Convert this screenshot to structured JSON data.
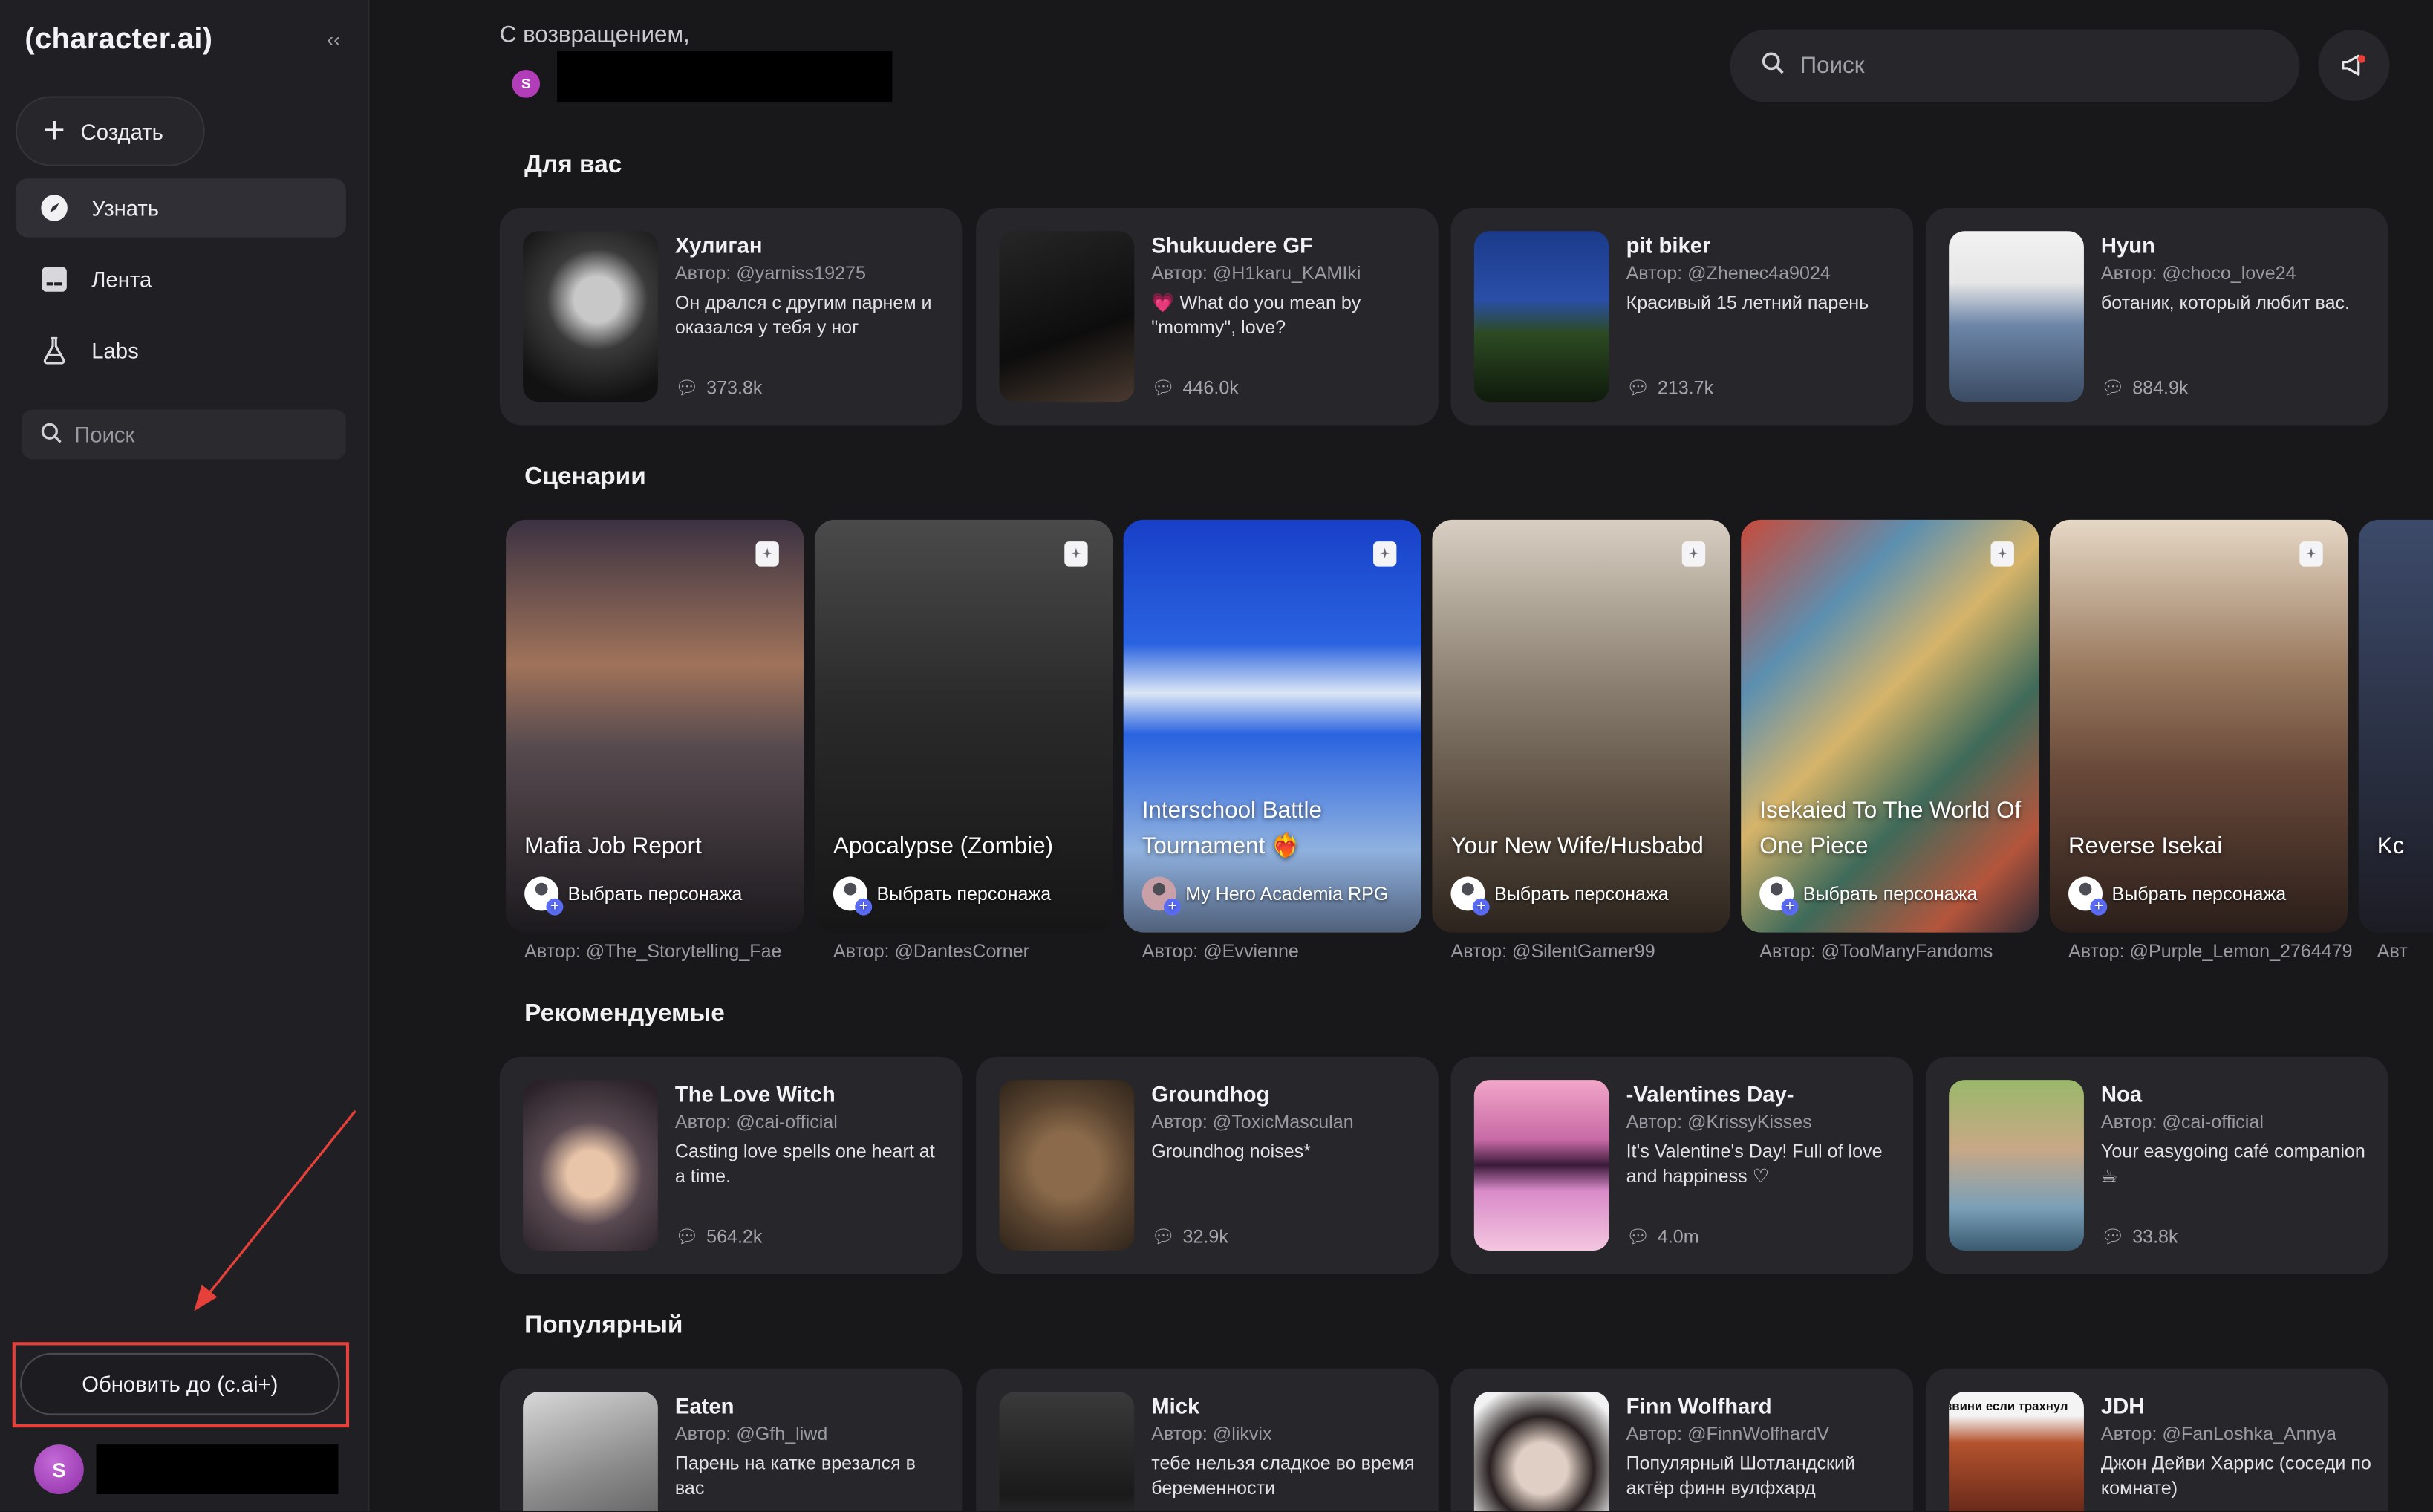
{
  "sidebar": {
    "logo": "(character.ai)",
    "collapse_icon": "‹‹",
    "create_label": "Создать",
    "nav": [
      {
        "label": "Узнать",
        "icon": "compass-icon",
        "active": true
      },
      {
        "label": "Лента",
        "icon": "feed-icon",
        "active": false
      },
      {
        "label": "Labs",
        "icon": "flask-icon",
        "active": false
      }
    ],
    "search_placeholder": "Поиск",
    "upgrade_label": "Обновить до (c.ai+)",
    "user_initial": "S"
  },
  "header": {
    "welcome": "С возвращением,",
    "user_initial": "S",
    "search_placeholder": "Поиск"
  },
  "sections": {
    "for_you": "Для вас",
    "scenarios": "Сценарии",
    "recommended": "Рекомендуемые",
    "popular": "Популярный"
  },
  "for_you": [
    {
      "name": "Хулиган",
      "author": "Автор: @yarniss19275",
      "desc": "Он дрался с другим парнем и оказался у тебя у ног",
      "count": "373.8k"
    },
    {
      "name": "Shukuudere GF",
      "author": "Автор: @H1karu_KAMIki",
      "desc": "💗 What do you mean by \"mommy\", love?",
      "count": "446.0k"
    },
    {
      "name": "pit biker",
      "author": "Автор: @Zhenec4a9024",
      "desc": "Красивый 15 летний парень",
      "count": "213.7k"
    },
    {
      "name": "Hyun",
      "author": "Автор: @choco_love24",
      "desc": "ботаник, который любит вас.",
      "count": "884.9k"
    }
  ],
  "scenarios": [
    {
      "title": "Mafia Job Report",
      "pick": "Выбрать персонажа",
      "author": "Автор: @The_Storytelling_Fae"
    },
    {
      "title": "Apocalypse (Zombie)",
      "pick": "Выбрать персонажа",
      "author": "Автор: @DantesCorner"
    },
    {
      "title": "Interschool Battle Tournament ❤️‍🔥",
      "pick": "My Hero Academia RPG",
      "author": "Автор: @Evvienne"
    },
    {
      "title": "Your New Wife/Husbabd",
      "pick": "Выбрать персонажа",
      "author": "Автор: @SilentGamer99"
    },
    {
      "title": "Isekaied To The World Of One Piece",
      "pick": "Выбрать персонажа",
      "author": "Автор: @TooManyFandoms"
    },
    {
      "title": "Reverse Isekai",
      "pick": "Выбрать персонажа",
      "author": "Автор: @Purple_Lemon_2764479"
    },
    {
      "title": "Kc",
      "pick": "",
      "author": "Авт"
    }
  ],
  "recommended": [
    {
      "name": "The Love Witch",
      "author": "Автор: @cai-official",
      "desc": "Casting love spells one heart at a time.",
      "count": "564.2k"
    },
    {
      "name": "Groundhog",
      "author": "Автор: @ToxicMasculan",
      "desc": "Groundhog noises*",
      "count": "32.9k"
    },
    {
      "name": "-Valentines Day-",
      "author": "Автор: @KrissyKisses",
      "desc": "It's Valentine's Day! Full of love and happiness ♡",
      "count": "4.0m"
    },
    {
      "name": "Noa",
      "author": "Автор: @cai-official",
      "desc": "Your easygoing café companion ☕",
      "count": "33.8k"
    }
  ],
  "popular": [
    {
      "name": "Eaten",
      "author": "Автор: @Gfh_liwd",
      "desc": "Парень на катке врезался в вас"
    },
    {
      "name": "Mick",
      "author": "Автор: @likvix",
      "desc": "тебе нельзя сладкое во время беременности"
    },
    {
      "name": "Finn Wolfhard",
      "author": "Автор: @FinnWolfhardV",
      "desc": "Популярный Шотландский актёр финн вулфхард"
    },
    {
      "name": "JDH",
      "author": "Автор: @FanLoshka_Annya",
      "desc": "Джон Дейви Харрис (соседи по комнате)",
      "img_caption": "звини если трахнул"
    }
  ]
}
